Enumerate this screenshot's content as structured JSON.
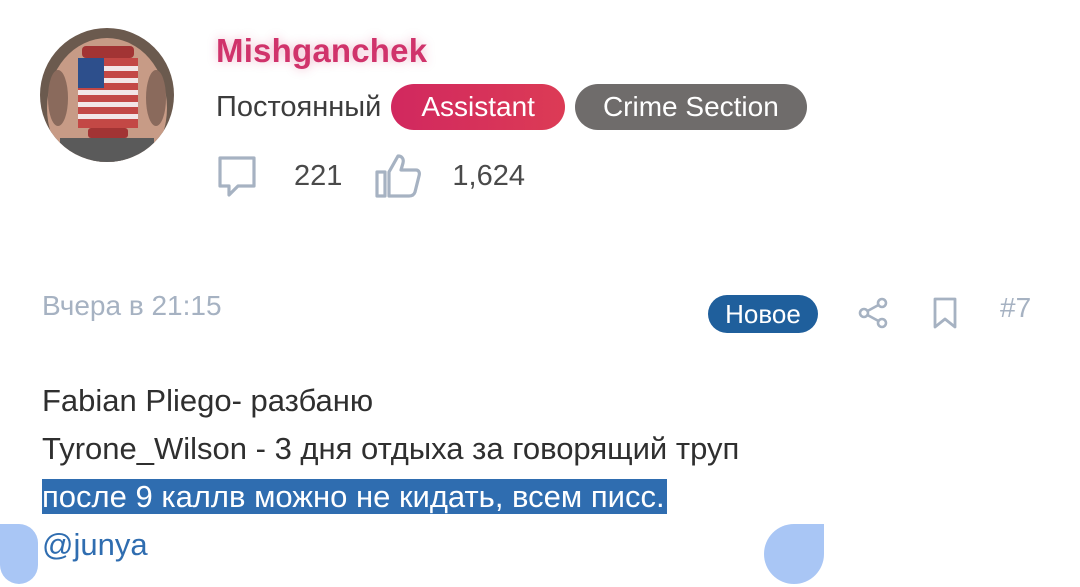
{
  "author": {
    "username": "Mishganchek",
    "role": "Постоянный",
    "badges": [
      {
        "label": "Assistant",
        "color": "#d1285f"
      },
      {
        "label": "Crime Section",
        "color": "#6f6c6b"
      }
    ],
    "stats": {
      "messages_icon": "message-icon",
      "messages": "221",
      "likes_icon": "thumbs-up-icon",
      "likes": "1,624"
    },
    "username_color": "#d0336b"
  },
  "post": {
    "date": "Вчера в 21:15",
    "new_label": "Новое",
    "share_icon": "share-icon",
    "bookmark_icon": "bookmark-icon",
    "number": "#7",
    "lines": [
      "Fabian Pliego- разбаню",
      "Tyrone_Wilson - 3 дня отдыха за говорящий труп",
      "после 9 каллв можно не кидать, всем писс."
    ],
    "mention": "@junya",
    "selection_color": "#2f6db0"
  }
}
